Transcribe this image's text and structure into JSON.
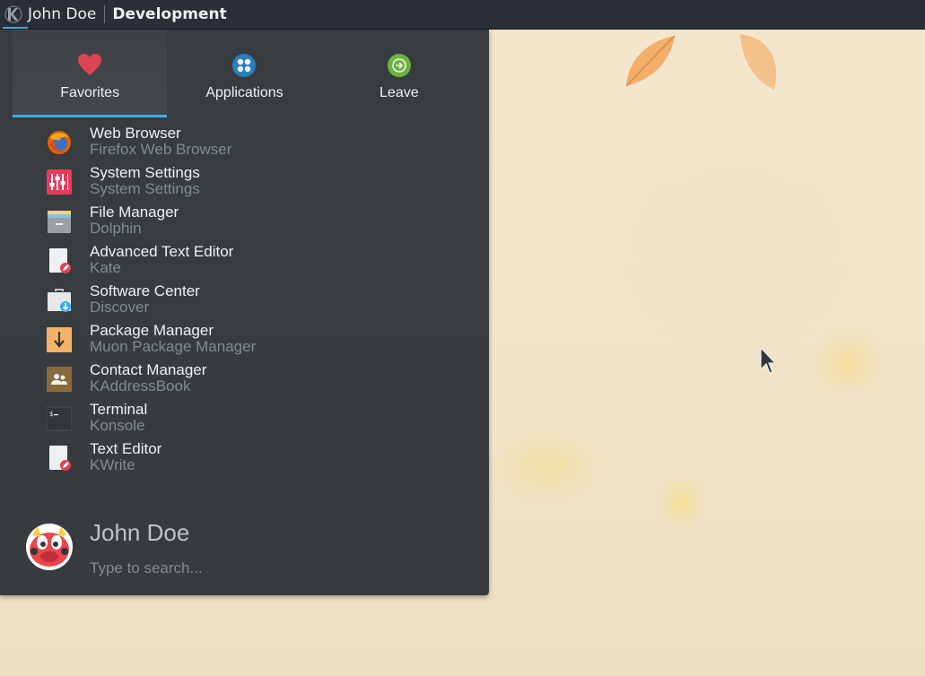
{
  "panel": {
    "user": "John Doe",
    "activity": "Development",
    "colors": {
      "background": "#2a2e35",
      "accent": "#3daee9"
    }
  },
  "launcher": {
    "tabs": [
      {
        "label": "Favorites",
        "icon": "heart-icon",
        "active": true
      },
      {
        "label": "Applications",
        "icon": "applications-grid-icon",
        "active": false
      },
      {
        "label": "Leave",
        "icon": "leave-arrow-icon",
        "active": false
      }
    ],
    "favorites": [
      {
        "name": "Web Browser",
        "desc": "Firefox Web Browser",
        "icon": "firefox-icon"
      },
      {
        "name": "System Settings",
        "desc": "System Settings",
        "icon": "system-settings-icon"
      },
      {
        "name": "File Manager",
        "desc": "Dolphin",
        "icon": "file-manager-icon"
      },
      {
        "name": "Advanced Text Editor",
        "desc": "Kate",
        "icon": "kate-icon"
      },
      {
        "name": "Software Center",
        "desc": "Discover",
        "icon": "software-center-icon"
      },
      {
        "name": "Package Manager",
        "desc": "Muon Package Manager",
        "icon": "package-manager-icon"
      },
      {
        "name": "Contact Manager",
        "desc": "KAddressBook",
        "icon": "contact-manager-icon"
      },
      {
        "name": "Terminal",
        "desc": "Konsole",
        "icon": "terminal-icon"
      },
      {
        "name": "Text Editor",
        "desc": "KWrite",
        "icon": "kwrite-icon"
      }
    ],
    "user": {
      "name": "John Doe",
      "avatar": "konqi-avatar"
    },
    "search": {
      "placeholder": "Type to search...",
      "value": ""
    }
  }
}
